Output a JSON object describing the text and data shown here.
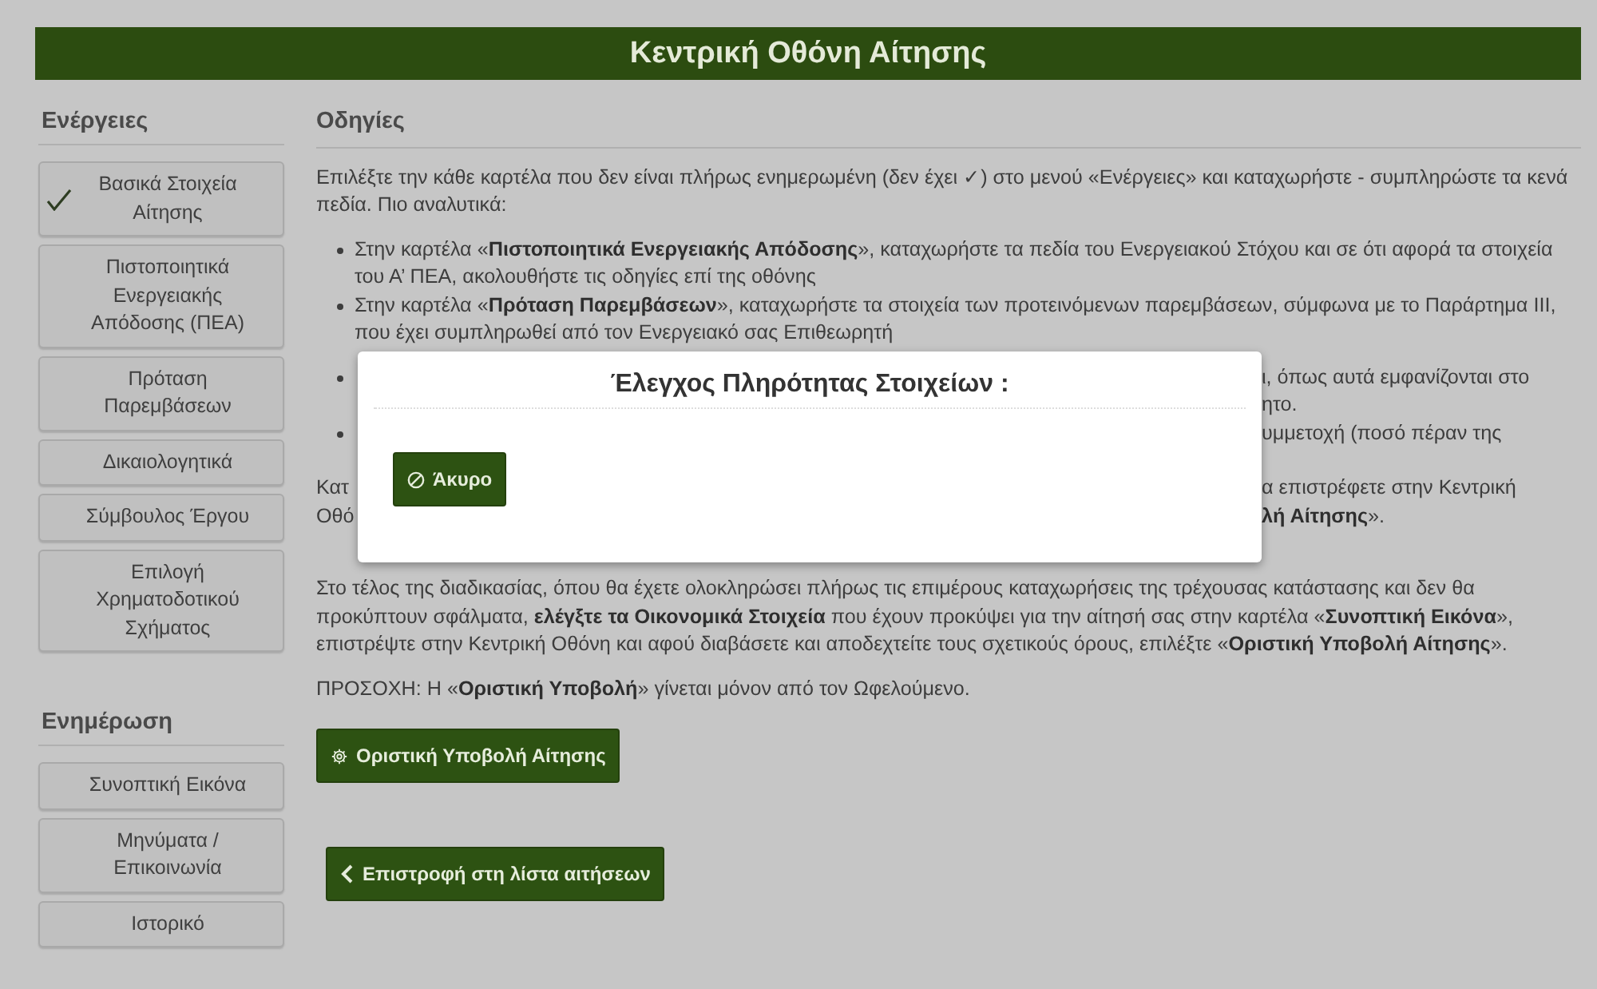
{
  "header": {
    "title": "Κεντρική Οθόνη Αίτησης"
  },
  "sidebar": {
    "sections": [
      {
        "title": "Ενέργειες",
        "items": [
          {
            "label": "Βασικά Στοιχεία Αίτησης",
            "checked": true
          },
          {
            "label": "Πιστοποιητικά Ενεργειακής Απόδοσης (ΠΕΑ)",
            "checked": false
          },
          {
            "label": "Πρόταση Παρεμβάσεων",
            "checked": false
          },
          {
            "label": "Δικαιολογητικά",
            "checked": false
          },
          {
            "label": "Σύμβουλος Έργου",
            "checked": false
          },
          {
            "label": "Επιλογή Χρηματοδοτικού Σχήματος",
            "checked": false
          }
        ]
      },
      {
        "title": "Ενημέρωση",
        "items": [
          {
            "label": "Συνοπτική Εικόνα",
            "checked": false
          },
          {
            "label": "Μηνύματα / Επικοινωνία",
            "checked": false
          },
          {
            "label": "Ιστορικό",
            "checked": false
          }
        ]
      }
    ]
  },
  "instructions": {
    "title": "Οδηγίες",
    "intro": "Επιλέξτε την κάθε καρτέλα που δεν είναι πλήρως ενημερωμένη (δεν έχει ✓) στο μενού «Ενέργειες» και καταχωρήστε - συμπληρώστε τα κενά πεδία. Πιο αναλυτικά:",
    "bullets": [
      {
        "kind": "full",
        "text": "Στην καρτέλα «**Πιστοποιητικά Ενεργειακής Απόδοσης**», καταχωρήστε τα πεδία του Ενεργειακού Στόχου και σε ότι αφορά τα στοιχεία του Α’ ΠΕΑ,  ακολουθήστε τις οδηγίες επί της οθόνης"
      },
      {
        "kind": "full",
        "text": "Στην καρτέλα «**Πρόταση Παρεμβάσεων**», καταχωρήστε τα στοιχεία των προτεινόμενων παρεμβάσεων, σύμφωνα με το Παράρτημα ΙΙΙ, που έχει συμπληρωθεί από τον Ενεργειακό σας Επιθεωρητή"
      },
      {
        "kind": "covered",
        "lines": [
          "ι, όπως αυτά εμφανίζονται στο",
          "ητο."
        ]
      },
      {
        "kind": "covered",
        "lines": [
          "υμμετοχή (ποσό πέραν της"
        ]
      }
    ],
    "covered_paragraph": [
      {
        "left": "Κατ",
        "right": "α επιστρέφετε στην Κεντρική"
      },
      {
        "left": "Οθό",
        "right": "**λή Αίτησης**»."
      }
    ],
    "paragraphs": [
      "Στο τέλος της διαδικασίας, όπου θα έχετε ολοκληρώσει πλήρως τις επιμέρους καταχωρήσεις της τρέχουσας κατάστασης και δεν θα προκύπτουν σφάλματα, **ελέγξτε τα Οικονομικά Στοιχεία** που έχουν προκύψει για την αίτησή σας στην καρτέλα «**Συνοπτική Εικόνα**», επιστρέψτε στην Κεντρική Οθόνη και αφού διαβάσετε και αποδεχτείτε τους σχετικούς όρους, επιλέξτε «**Οριστική Υποβολή Αίτησης**».",
      "ΠΡΟΣΟΧΗ: Η «**Οριστική Υποβολή**» γίνεται μόνον από τον Ωφελούμενο."
    ]
  },
  "submit_button": "Οριστική Υποβολή Αίτησης",
  "back_button": "Επιστροφή στη λίστα αιτήσεων",
  "modal": {
    "title": "Έλεγχος Πληρότητας Στοιχείων :",
    "cancel_button": "Άκυρο"
  }
}
